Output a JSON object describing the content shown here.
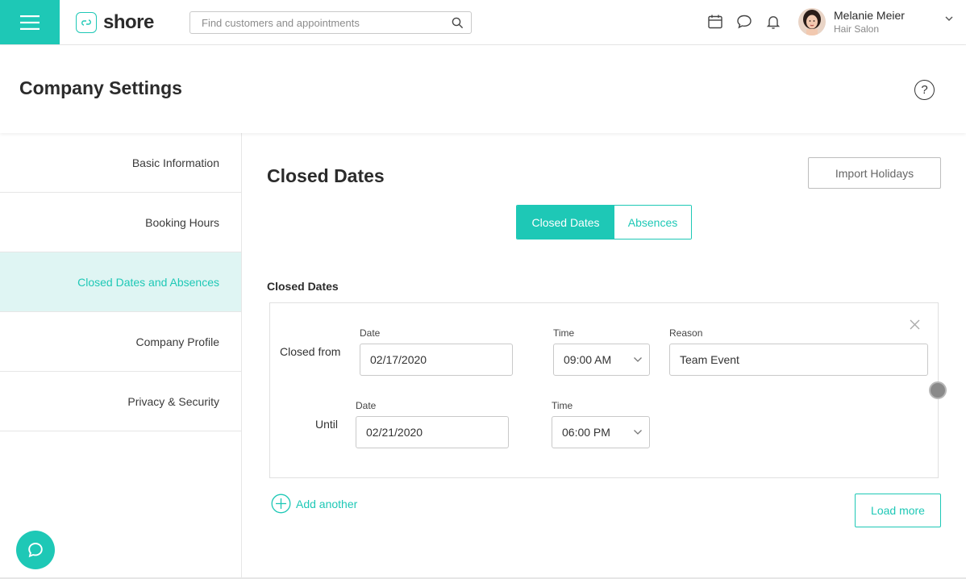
{
  "header": {
    "logo_text": "shore",
    "search_placeholder": "Find customers and appointments",
    "user": {
      "name": "Melanie Meier",
      "subtitle": "Hair Salon"
    }
  },
  "page": {
    "title": "Company Settings",
    "help_label": "?"
  },
  "sidebar": {
    "items": [
      {
        "label": "Basic Information",
        "active": false
      },
      {
        "label": "Booking Hours",
        "active": false
      },
      {
        "label": "Closed Dates and Absences",
        "active": true
      },
      {
        "label": "Company Profile",
        "active": false
      },
      {
        "label": "Privacy & Security",
        "active": false
      }
    ]
  },
  "main": {
    "title": "Closed Dates",
    "import_button": "Import Holidays",
    "tabs": [
      {
        "label": "Closed Dates",
        "active": true
      },
      {
        "label": "Absences",
        "active": false
      }
    ],
    "section_title": "Closed Dates",
    "entry": {
      "from_label": "Closed from",
      "until_label": "Until",
      "date_label": "Date",
      "time_label": "Time",
      "reason_label": "Reason",
      "from_date": "02/17/2020",
      "from_time": "09:00 AM",
      "reason": "Team Event",
      "until_date": "02/21/2020",
      "until_time": "06:00 PM"
    },
    "add_another": "Add another",
    "load_more": "Load more"
  },
  "colors": {
    "accent": "#1ec8b6",
    "active_bg": "#dff5f3"
  },
  "icons": [
    "hamburger-icon",
    "shore-logo-icon",
    "search-icon",
    "calendar-icon",
    "chat-icon",
    "bell-icon",
    "chevron-down-icon",
    "help-icon",
    "close-icon",
    "plus-circle-icon",
    "chat-bubble-icon"
  ]
}
